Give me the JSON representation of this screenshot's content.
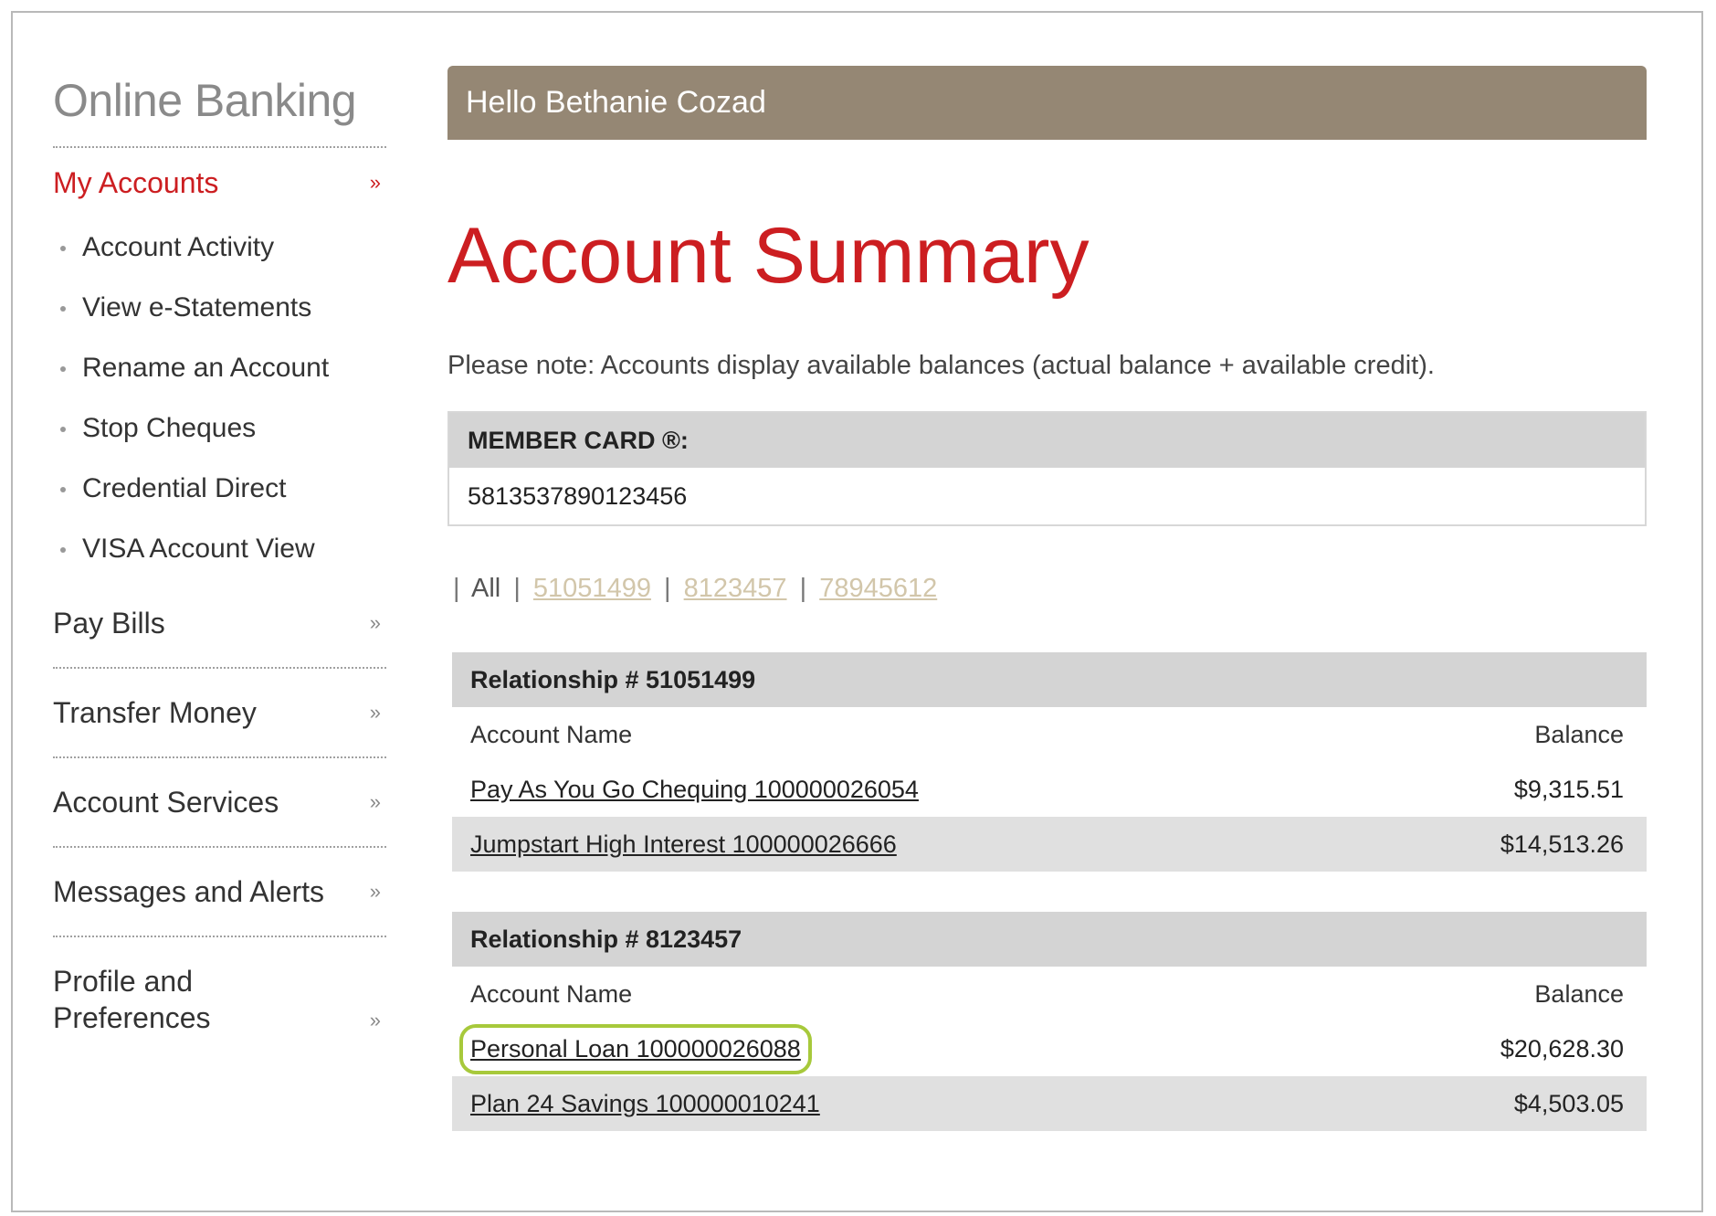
{
  "sidebar": {
    "brand": "Online Banking",
    "my_accounts": {
      "label": "My Accounts",
      "items": [
        "Account Activity",
        "View e-Statements",
        "Rename an Account",
        "Stop Cheques",
        "Credential Direct",
        "VISA Account View"
      ]
    },
    "sections": [
      "Pay Bills",
      "Transfer Money",
      "Account Services",
      "Messages and Alerts"
    ],
    "profile": {
      "line1": "Profile and",
      "line2": "Preferences"
    },
    "chevron": "»"
  },
  "header": {
    "greeting": "Hello Bethanie Cozad"
  },
  "main": {
    "title": "Account Summary",
    "note": "Please note: Accounts display available balances (actual balance + available credit).",
    "member_card": {
      "label": "MEMBER CARD ®:",
      "number": "5813537890123456"
    },
    "filter": {
      "all": "All",
      "links": [
        "51051499",
        "8123457",
        "78945612"
      ]
    },
    "relationships": [
      {
        "title": "Relationship # 51051499",
        "col_name": "Account Name",
        "col_balance": "Balance",
        "accounts": [
          {
            "name": "Pay As You Go Chequing 100000026054",
            "balance": "$9,315.51"
          },
          {
            "name": "Jumpstart High Interest 100000026666",
            "balance": "$14,513.26"
          }
        ]
      },
      {
        "title": "Relationship # 8123457",
        "col_name": "Account Name",
        "col_balance": "Balance",
        "accounts": [
          {
            "name": "Personal Loan 100000026088",
            "balance": "$20,628.30"
          },
          {
            "name": "Plan 24 Savings 100000010241",
            "balance": "$4,503.05"
          }
        ]
      }
    ],
    "highlight_color": "#a7c93b"
  },
  "colors": {
    "accent_red": "#cc1e21",
    "header_bar": "#958774",
    "link_tan": "#d2c6aa"
  }
}
